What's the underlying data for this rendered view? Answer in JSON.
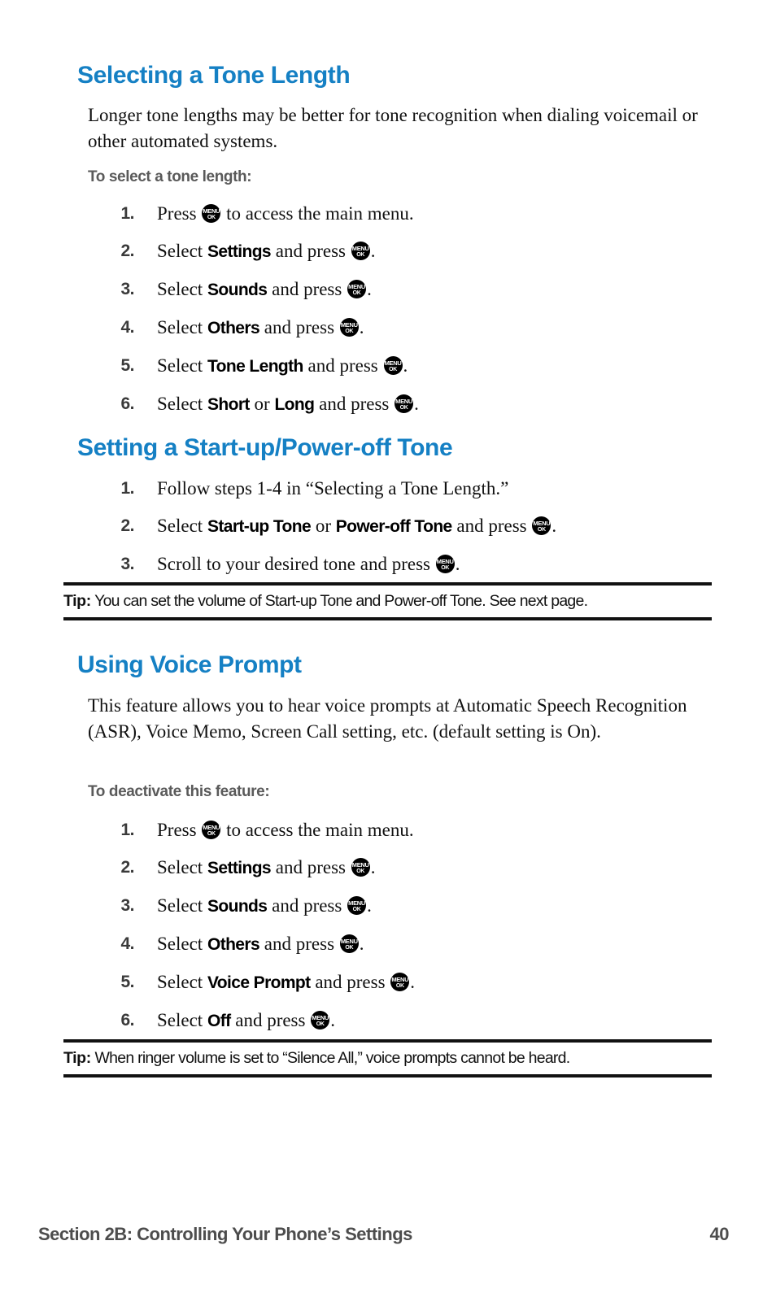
{
  "document": {
    "type": "phone-user-guide-page",
    "accent_color": "#1580c4",
    "label_gray": "#5a5a5a",
    "footer_gray": "#4d4d4d"
  },
  "menu_key": {
    "line1": "MENU",
    "line2": "OK",
    "icon_name": "menu-ok-key-icon"
  },
  "sections": {
    "tone_length": {
      "heading": "Selecting a Tone Length",
      "paragraph": "Longer tone lengths may be better for tone recognition when dialing voicemail or other automated systems.",
      "lead_label": "To select a tone length:",
      "steps": [
        {
          "num": "1.",
          "pre": "Press ",
          "term": "",
          "mid": "",
          "term2": "",
          "post": " to access the main menu.",
          "key_after_pre": true,
          "key_at_end": false
        },
        {
          "num": "2.",
          "pre": "Select ",
          "term": "Settings",
          "mid": " and press ",
          "term2": "",
          "post": ".",
          "key_after_pre": false,
          "key_at_end": true
        },
        {
          "num": "3.",
          "pre": "Select ",
          "term": "Sounds",
          "mid": " and press ",
          "term2": "",
          "post": ".",
          "key_after_pre": false,
          "key_at_end": true
        },
        {
          "num": "4.",
          "pre": "Select ",
          "term": "Others",
          "mid": " and press ",
          "term2": "",
          "post": ".",
          "key_after_pre": false,
          "key_at_end": true
        },
        {
          "num": "5.",
          "pre": "Select ",
          "term": "Tone Length",
          "mid": " and press ",
          "term2": "",
          "post": ".",
          "key_after_pre": false,
          "key_at_end": true
        },
        {
          "num": "6.",
          "pre": "Select ",
          "term": "Short",
          "mid": " or ",
          "term2": "Long",
          "post2": " and press ",
          "post": ".",
          "key_after_pre": false,
          "key_at_end": true
        }
      ]
    },
    "startup_tone": {
      "heading": "Setting a Start-up/Power-off Tone",
      "steps": [
        {
          "num": "1.",
          "text": "Follow steps 1-4 in “Selecting a Tone Length.”"
        },
        {
          "num": "2.",
          "pre": "Select ",
          "term": "Start-up Tone",
          "mid": " or ",
          "term2": "Power-off Tone",
          "post2": " and press ",
          "post": "."
        },
        {
          "num": "3.",
          "pre": "Scroll to your desired tone and press ",
          "post": "."
        }
      ],
      "tip": {
        "label": "Tip:",
        "text": "You can set the volume of Start-up Tone and Power-off Tone. See next page."
      }
    },
    "voice_prompt": {
      "heading": "Using Voice Prompt",
      "paragraph": "This feature allows you to hear voice prompts at Automatic Speech Recognition (ASR), Voice Memo, Screen Call setting, etc. (default setting is On).",
      "lead_label": "To deactivate this feature:",
      "steps": [
        {
          "num": "1.",
          "pre": "Press ",
          "post": " to access the main menu."
        },
        {
          "num": "2.",
          "pre": "Select ",
          "term": "Settings",
          "mid": " and press ",
          "post": "."
        },
        {
          "num": "3.",
          "pre": "Select ",
          "term": "Sounds",
          "mid": " and press ",
          "post": "."
        },
        {
          "num": "4.",
          "pre": "Select ",
          "term": "Others",
          "mid": " and press ",
          "post": "."
        },
        {
          "num": "5.",
          "pre": "Select ",
          "term": "Voice Prompt",
          "mid": " and press ",
          "post": "."
        },
        {
          "num": "6.",
          "pre": "Select ",
          "term": "Off",
          "mid": " and press ",
          "post": "."
        }
      ],
      "tip": {
        "label": "Tip:",
        "text": "When ringer volume is set to “Silence All,” voice prompts cannot be heard."
      }
    }
  },
  "footer": {
    "section_label": "Section 2B: Controlling Your Phone’s Settings",
    "page_number": "40"
  }
}
